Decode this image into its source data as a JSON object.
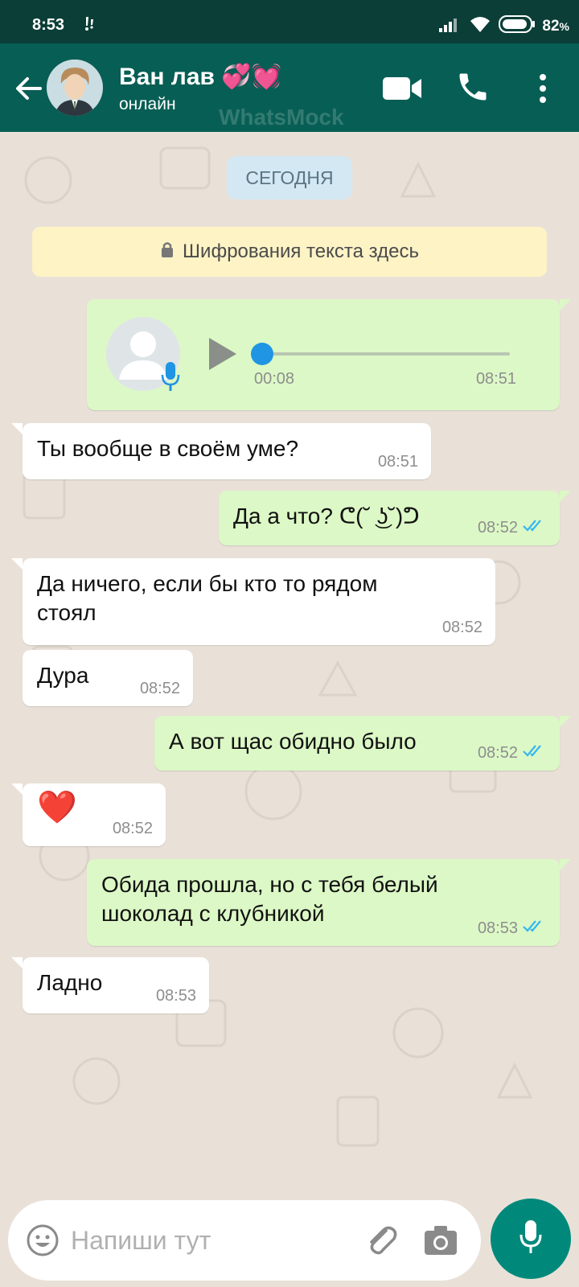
{
  "statusbar": {
    "time": "8:53",
    "battery_percent": "82",
    "battery_suffix": "%",
    "notification_icon": "exclamation-icon",
    "icons": [
      "signal-icon",
      "wifi-icon",
      "battery-icon"
    ]
  },
  "header": {
    "contact_name": "Ван лав 💞💓",
    "status": "онлайн",
    "watermark": "WhatsMock",
    "icons": [
      "back-arrow-icon",
      "avatar",
      "video-call-icon",
      "phone-icon",
      "more-vert-icon"
    ],
    "colors": {
      "statusbar": "#0b3e37",
      "appbar": "#075e54"
    }
  },
  "chat": {
    "date_chip": "СЕГОДНЯ",
    "encryption_notice": "Шифрования текста здесь",
    "voice_message": {
      "duration": "00:08",
      "time": "08:51",
      "progress": 0
    },
    "messages": [
      {
        "direction": "in",
        "text": "Ты вообще в своём уме?",
        "time": "08:51"
      },
      {
        "direction": "out",
        "text": "Да а что? ᕦ(˘ ͜ʖ˘)ᕤ",
        "time": "08:52",
        "status": "read"
      },
      {
        "direction": "in",
        "text": "Да ничего, если бы кто то рядом стоял",
        "time": "08:52"
      },
      {
        "direction": "in",
        "text": "Дура",
        "time": "08:52"
      },
      {
        "direction": "out",
        "text": "А вот щас обидно было",
        "time": "08:52",
        "status": "read"
      },
      {
        "direction": "in",
        "text": "❤️",
        "time": "08:52"
      },
      {
        "direction": "out",
        "text": "Обида прошла, но с тебя белый шоколад с клубникой",
        "time": "08:53",
        "status": "read"
      },
      {
        "direction": "in",
        "text": "Ладно",
        "time": "08:53"
      }
    ],
    "colors": {
      "incoming": "#ffffff",
      "outgoing": "#dcf8c6",
      "read_ticks": "#34b7f1",
      "background": "#e9e1d8"
    }
  },
  "composer": {
    "placeholder": "Напиши тут",
    "icons": [
      "emoji-icon",
      "attach-icon",
      "camera-icon",
      "mic-icon"
    ],
    "fab_color": "#00897b"
  }
}
